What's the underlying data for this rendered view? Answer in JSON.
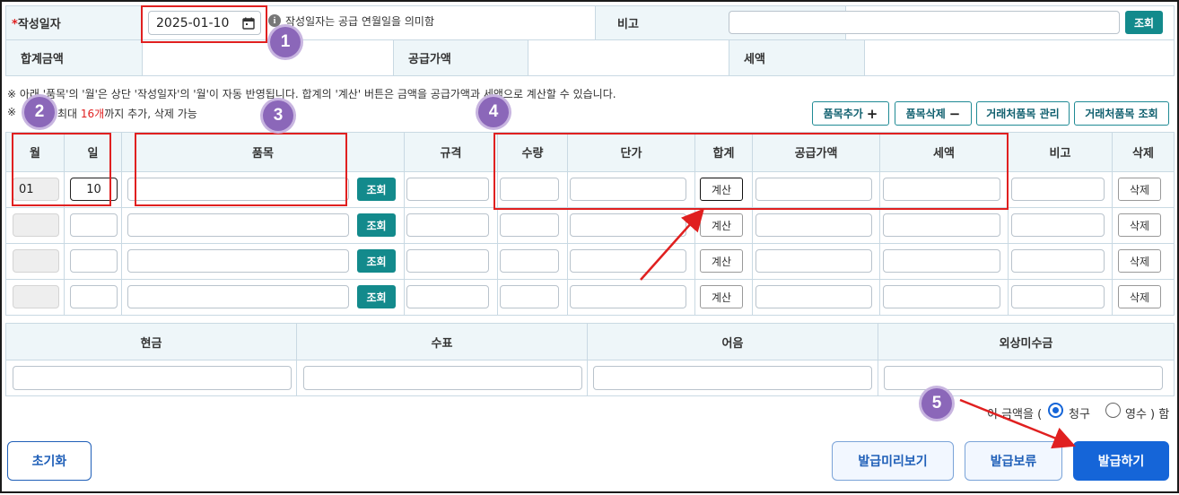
{
  "top": {
    "date_label": "작성일자",
    "required_mark": "*",
    "date_value": "2025-01-10",
    "date_hint": "작성일자는 공급 연월일을 의미함",
    "remarks_label": "비고",
    "remarks_value": "",
    "lookup_label": "조회",
    "total_label": "합계금액",
    "supply_label": "공급가액",
    "tax_label": "세액"
  },
  "notes": {
    "note1": "※ 아래 '품목'의 '월'은 상단 '작성일자'의 '월'이 자동 반영됩니다. 합계의 '계산' 버튼은 금액을 공급가액과 세액으로 계산할 수 있습니다.",
    "note2_prefix": "※",
    "note2_a": "최대 ",
    "note2_count": "16개",
    "note2_b": "까지 추가, 삭제 가능"
  },
  "toolbar": {
    "add_item": "품목추가",
    "delete_item": "품목삭제",
    "manage_items": "거래처품목 관리",
    "lookup_items": "거래처품목 조회"
  },
  "items_table": {
    "headers": {
      "month": "월",
      "day": "일",
      "item": "품목",
      "spec": "규격",
      "qty": "수량",
      "unit_price": "단가",
      "sum": "합계",
      "supply": "공급가액",
      "tax": "세액",
      "remarks": "비고",
      "delete": "삭제"
    },
    "lookup_label": "조회",
    "calc_label": "계산",
    "delete_label": "삭제",
    "rows": [
      {
        "month": "01",
        "day": "10"
      },
      {
        "month": "",
        "day": ""
      },
      {
        "month": "",
        "day": ""
      },
      {
        "month": "",
        "day": ""
      }
    ]
  },
  "payment": {
    "cash": "현금",
    "check": "수표",
    "note": "어음",
    "credit": "외상미수금"
  },
  "amount_type": {
    "prefix": "이 금액을 (",
    "claim": "청구",
    "receipt": "영수 ) 함",
    "selected": "청구"
  },
  "actions": {
    "reset": "초기화",
    "preview": "발급미리보기",
    "hold": "발급보류",
    "issue": "발급하기"
  },
  "annotations": [
    "1",
    "2",
    "3",
    "4",
    "5"
  ],
  "colors": {
    "teal": "#138a8c",
    "primary_blue": "#1565d8",
    "highlight_red": "#e02020",
    "badge_purple": "#8b67b9",
    "header_bg": "#eef6f9"
  }
}
